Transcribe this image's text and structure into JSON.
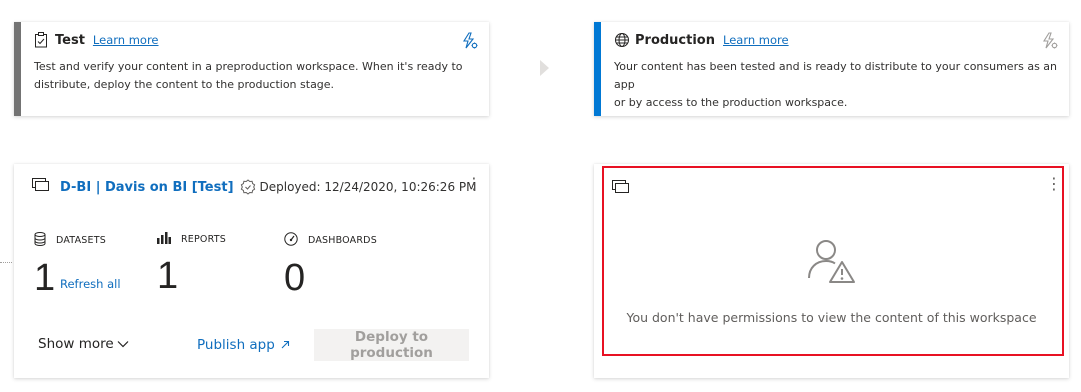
{
  "stages": {
    "test": {
      "title": "Test",
      "learn_more": "Learn more",
      "description_line1": "Test and verify your content in a preproduction workspace. When it's ready to",
      "description_line2": "distribute, deploy the content to the production stage.",
      "bar_color": "#737373"
    },
    "production": {
      "title": "Production",
      "learn_more": "Learn more",
      "description_line1": "Your content has been tested and is ready to distribute to your consumers as an app",
      "description_line2": "or by access to the production workspace.",
      "bar_color": "#0078d4"
    }
  },
  "test_workspace": {
    "name": "D-BI | Davis on BI [Test]",
    "deployed": "Deployed: 12/24/2020, 10:26:26 PM",
    "metrics": [
      {
        "label": "DATASETS",
        "value": "1",
        "icon": "database-icon"
      },
      {
        "label": "REPORTS",
        "value": "1",
        "icon": "bar-chart-icon"
      },
      {
        "label": "DASHBOARDS",
        "value": "0",
        "icon": "gauge-icon"
      }
    ],
    "refresh_all": "Refresh all",
    "show_more": "Show more",
    "publish_app": "Publish app",
    "deploy_button": "Deploy to production"
  },
  "production_workspace": {
    "no_permission_message": "You don't have permissions to view the content of this workspace"
  },
  "colors": {
    "accent": "#106ebe",
    "highlight": "#e81123"
  }
}
